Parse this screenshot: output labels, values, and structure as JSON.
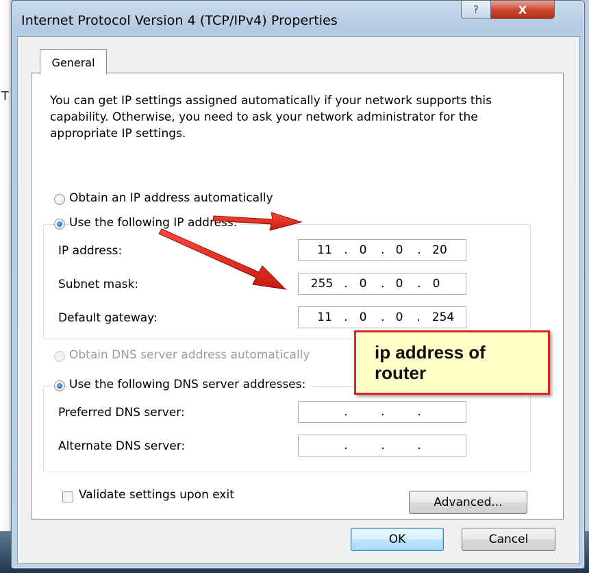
{
  "window": {
    "title": "Internet Protocol Version 4 (TCP/IPv4) Properties",
    "help_glyph": "?",
    "close_glyph": "X"
  },
  "background": {
    "left_glyph": "T"
  },
  "tabs": [
    {
      "label": "General",
      "selected": true
    }
  ],
  "description": "You can get IP settings assigned automatically if your network supports this capability. Otherwise, you need to ask your network administrator for the appropriate IP settings.",
  "ip_section": {
    "auto_label": "Obtain an IP address automatically",
    "auto_selected": false,
    "manual_label": "Use the following IP address:",
    "manual_selected": true,
    "fields": [
      {
        "label": "IP address:",
        "octets": [
          "11",
          "0",
          "0",
          "20"
        ]
      },
      {
        "label": "Subnet mask:",
        "octets": [
          "255",
          "0",
          "0",
          "0"
        ]
      },
      {
        "label": "Default gateway:",
        "octets": [
          "11",
          "0",
          "0",
          "254"
        ]
      }
    ]
  },
  "dns_section": {
    "auto_label": "Obtain DNS server address automatically",
    "auto_selected": false,
    "auto_disabled": true,
    "manual_label": "Use the following DNS server addresses:",
    "manual_selected": true,
    "fields": [
      {
        "label": "Preferred DNS server:",
        "octets": [
          "",
          "",
          "",
          ""
        ]
      },
      {
        "label": "Alternate DNS server:",
        "octets": [
          "",
          "",
          "",
          ""
        ]
      }
    ]
  },
  "validate": {
    "label": "Validate settings upon exit",
    "checked": false
  },
  "buttons": {
    "advanced": "Advanced...",
    "ok": "OK",
    "cancel": "Cancel"
  },
  "annotation": {
    "callout_line1": "ip address of",
    "callout_line2": "router",
    "arrow_color": "#e02020",
    "callout_border": "#e02222",
    "callout_fill": "#ffffc8"
  },
  "colors": {
    "title_bar": "#c7daee",
    "close_button": "#c8442c",
    "radio_selected": "#1b4f96"
  }
}
